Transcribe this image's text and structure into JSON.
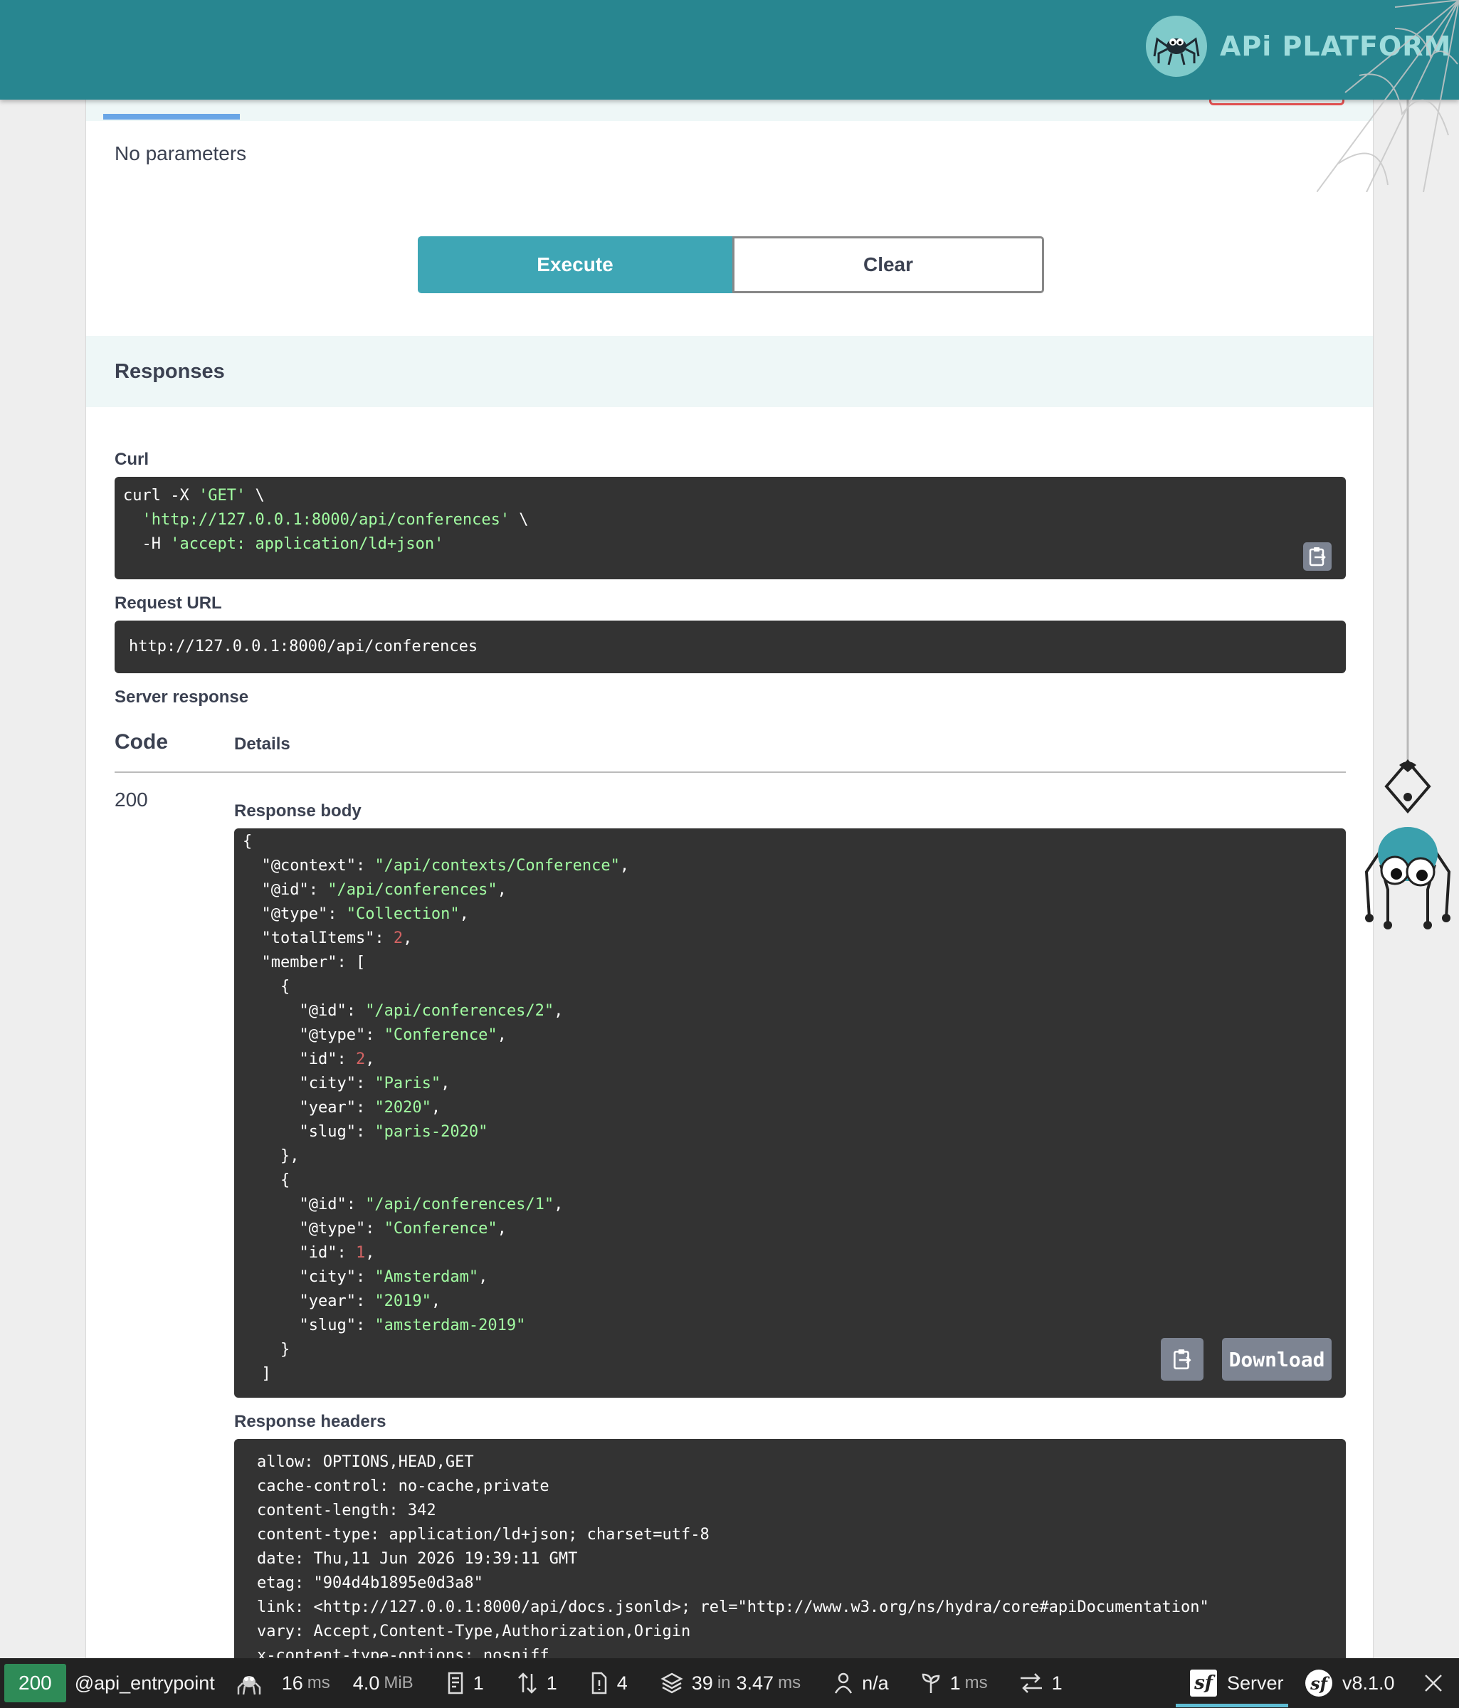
{
  "header": {
    "brand": "APi PLATFORM"
  },
  "operation": {
    "no_params": "No parameters",
    "execute_label": "Execute",
    "clear_label": "Clear"
  },
  "responses": {
    "title": "Responses",
    "curl_label": "Curl",
    "curl_lines": [
      {
        "plain": "curl -X ",
        "str": "'GET'",
        "tail": " \\"
      },
      {
        "plain": "  ",
        "str": "'http://127.0.0.1:8000/api/conferences'",
        "tail": " \\"
      },
      {
        "plain": "  -H ",
        "str": "'accept: application/ld+json'",
        "tail": ""
      }
    ],
    "request_url_label": "Request URL",
    "request_url": "http://127.0.0.1:8000/api/conferences",
    "server_response_label": "Server response",
    "code_header": "Code",
    "details_header": "Details",
    "status_code": "200",
    "response_body_label": "Response body",
    "download_label": "Download",
    "response_headers_label": "Response headers",
    "response_headers": [
      "allow: OPTIONS,HEAD,GET",
      "cache-control: no-cache,private",
      "content-length: 342",
      "content-type: application/ld+json; charset=utf-8",
      "date: Thu,11 Jun 2026 19:39:11 GMT",
      "etag: \"904d4b1895e0d3a8\"",
      "link: <http://127.0.0.1:8000/api/docs.jsonld>; rel=\"http://www.w3.org/ns/hydra/core#apiDocumentation\"",
      "vary: Accept,Content-Type,Authorization,Origin",
      "x-content-type-options: nosniff"
    ]
  },
  "response_body": [
    [
      {
        "t": "p",
        "v": "{"
      }
    ],
    [
      {
        "t": "p",
        "v": "  \"@context\": "
      },
      {
        "t": "s",
        "v": "\"/api/contexts/Conference\""
      },
      {
        "t": "p",
        "v": ","
      }
    ],
    [
      {
        "t": "p",
        "v": "  \"@id\": "
      },
      {
        "t": "s",
        "v": "\"/api/conferences\""
      },
      {
        "t": "p",
        "v": ","
      }
    ],
    [
      {
        "t": "p",
        "v": "  \"@type\": "
      },
      {
        "t": "s",
        "v": "\"Collection\""
      },
      {
        "t": "p",
        "v": ","
      }
    ],
    [
      {
        "t": "p",
        "v": "  \"totalItems\": "
      },
      {
        "t": "n",
        "v": "2"
      },
      {
        "t": "p",
        "v": ","
      }
    ],
    [
      {
        "t": "p",
        "v": "  \"member\": ["
      }
    ],
    [
      {
        "t": "p",
        "v": "    {"
      }
    ],
    [
      {
        "t": "p",
        "v": "      \"@id\": "
      },
      {
        "t": "s",
        "v": "\"/api/conferences/2\""
      },
      {
        "t": "p",
        "v": ","
      }
    ],
    [
      {
        "t": "p",
        "v": "      \"@type\": "
      },
      {
        "t": "s",
        "v": "\"Conference\""
      },
      {
        "t": "p",
        "v": ","
      }
    ],
    [
      {
        "t": "p",
        "v": "      \"id\": "
      },
      {
        "t": "n",
        "v": "2"
      },
      {
        "t": "p",
        "v": ","
      }
    ],
    [
      {
        "t": "p",
        "v": "      \"city\": "
      },
      {
        "t": "s",
        "v": "\"Paris\""
      },
      {
        "t": "p",
        "v": ","
      }
    ],
    [
      {
        "t": "p",
        "v": "      \"year\": "
      },
      {
        "t": "s",
        "v": "\"2020\""
      },
      {
        "t": "p",
        "v": ","
      }
    ],
    [
      {
        "t": "p",
        "v": "      \"slug\": "
      },
      {
        "t": "s",
        "v": "\"paris-2020\""
      }
    ],
    [
      {
        "t": "p",
        "v": "    },"
      }
    ],
    [
      {
        "t": "p",
        "v": "    {"
      }
    ],
    [
      {
        "t": "p",
        "v": "      \"@id\": "
      },
      {
        "t": "s",
        "v": "\"/api/conferences/1\""
      },
      {
        "t": "p",
        "v": ","
      }
    ],
    [
      {
        "t": "p",
        "v": "      \"@type\": "
      },
      {
        "t": "s",
        "v": "\"Conference\""
      },
      {
        "t": "p",
        "v": ","
      }
    ],
    [
      {
        "t": "p",
        "v": "      \"id\": "
      },
      {
        "t": "n",
        "v": "1"
      },
      {
        "t": "p",
        "v": ","
      }
    ],
    [
      {
        "t": "p",
        "v": "      \"city\": "
      },
      {
        "t": "s",
        "v": "\"Amsterdam\""
      },
      {
        "t": "p",
        "v": ","
      }
    ],
    [
      {
        "t": "p",
        "v": "      \"year\": "
      },
      {
        "t": "s",
        "v": "\"2019\""
      },
      {
        "t": "p",
        "v": ","
      }
    ],
    [
      {
        "t": "p",
        "v": "      \"slug\": "
      },
      {
        "t": "s",
        "v": "\"amsterdam-2019\""
      }
    ],
    [
      {
        "t": "p",
        "v": "    }"
      }
    ],
    [
      {
        "t": "p",
        "v": "  ]"
      }
    ]
  ],
  "toolbar": {
    "status": "200",
    "route": "@api_entrypoint",
    "time_value": "16",
    "time_unit": "ms",
    "memory_value": "4.0",
    "memory_unit": "MiB",
    "logs_count": "1",
    "requests_count": "1",
    "forms_count": "4",
    "cache_calls": "39",
    "cache_in": "in",
    "cache_time": "3.47",
    "cache_unit": "ms",
    "user": "n/a",
    "init_value": "1",
    "init_unit": "ms",
    "http_count": "1",
    "server_label": "Server",
    "version": "v8.1.0",
    "colors": {
      "status_ok": "#2e8b57",
      "accent": "#5fbcd3"
    }
  },
  "colors": {
    "header_bg": "#288690",
    "execute_bg": "#3ea6b5",
    "code_bg": "#333333",
    "code_string": "#a2fca2",
    "code_number": "#d36363"
  }
}
